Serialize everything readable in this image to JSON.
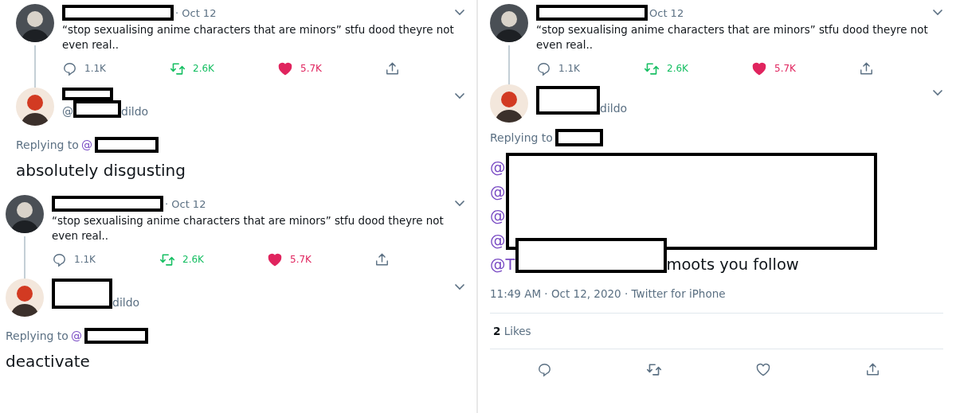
{
  "panels": [
    {
      "kind": "thread",
      "quoted": {
        "date": "· Oct 12",
        "text": "“stop sexualising anime characters that are minors” stfu dood theyre not even real..",
        "replies": "1.1K",
        "retweets": "2.6K",
        "likes": "5.7K",
        "retweeted": true,
        "liked": true
      },
      "reply": {
        "handle_prefix": "@",
        "handle_suffix": "dildo",
        "replying_to": "Replying to",
        "replying_at": "@",
        "text": "absolutely disgusting"
      }
    },
    {
      "kind": "thread",
      "quoted": {
        "date": "· Oct 12",
        "text": "“stop sexualising anime characters that are minors” stfu dood theyre not even real..",
        "replies": "1.1K",
        "retweets": "2.6K",
        "likes": "5.7K",
        "retweeted": true,
        "liked": true
      },
      "reply": {
        "handle_suffix": "dildo",
        "replying_to": "Replying to",
        "replying_at": "@",
        "text": "deactivate"
      }
    },
    {
      "kind": "detail",
      "quoted": {
        "date": "Oct 12",
        "text": "“stop sexualising anime characters that are minors” stfu dood theyre not even real..",
        "replies": "1.1K",
        "retweets": "2.6K",
        "likes": "5.7K",
        "retweeted": true,
        "liked": true
      },
      "reply": {
        "handle_suffix": "dildo",
        "replying_to": "Replying to",
        "mentions": [
          "@",
          "@",
          "@",
          "@"
        ],
        "last_mention": "@T",
        "text": "moots you follow",
        "timestamp": "11:49 AM · Oct 12, 2020 · Twitter for iPhone",
        "likes_count": "2",
        "likes_label": "Likes",
        "liked": false,
        "retweeted": false
      }
    }
  ]
}
